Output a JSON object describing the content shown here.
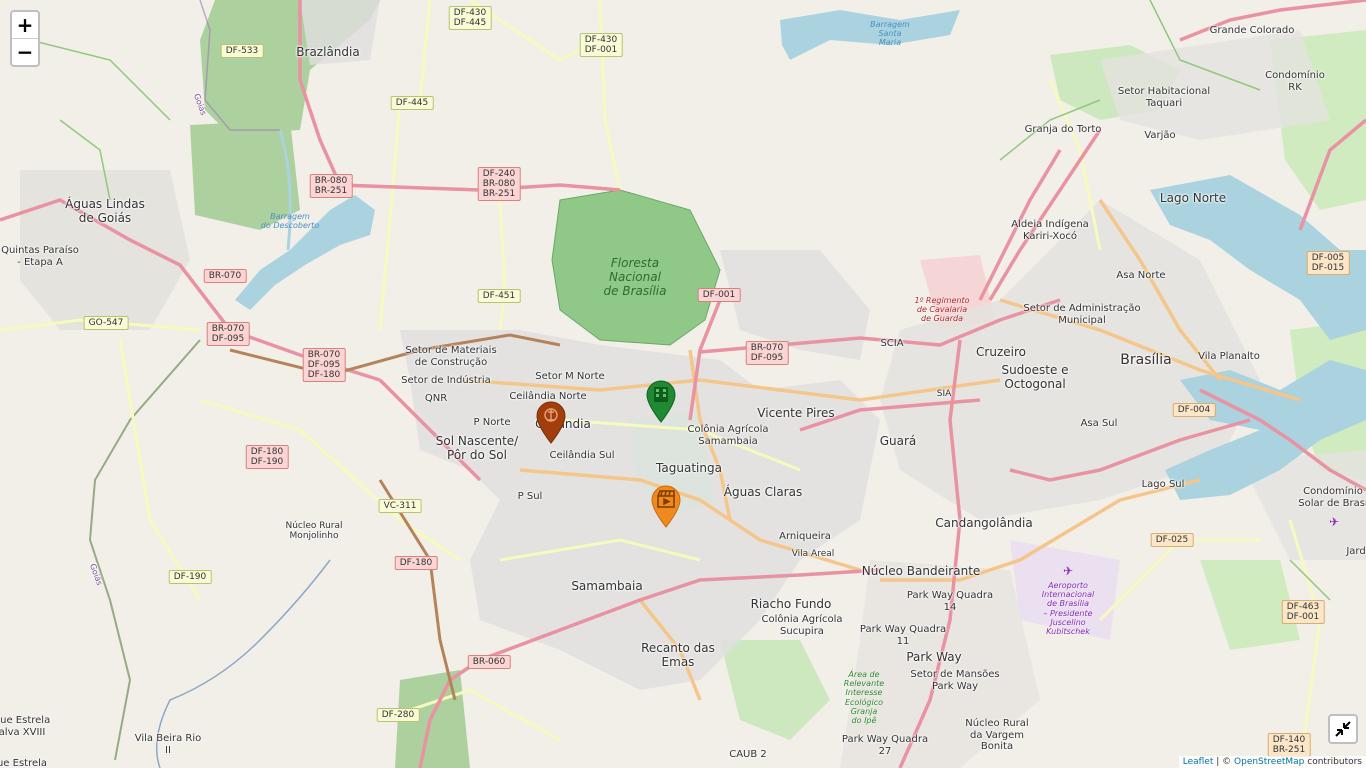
{
  "controls": {
    "zoom_in": "+",
    "zoom_out": "−",
    "fullscreen_icon": "collapse-arrows-icon"
  },
  "attribution": {
    "leaflet": "Leaflet",
    "sep": " | © ",
    "osm": "OpenStreetMap",
    "suffix": " contributors"
  },
  "colors": {
    "land": "#f2efe9",
    "water": "#aad3df",
    "forest": "#add19e",
    "park": "#c8facc",
    "road_major": "#e892a2",
    "road_primary": "#fcd6a4",
    "road_secondary": "#f7fabf",
    "marker_red": "#a23d0c",
    "marker_green": "#1f8a32",
    "marker_orange": "#f18a1e"
  },
  "places": {
    "brazlandia": "Brazlândia",
    "aguas_lindas": "Águas Lindas\nde Goiás",
    "quintas": "Quintas Paraíso\n- Etapa A",
    "grande_colorado": "Grande Colorado",
    "condominio_rk": "Condomínio\nRK",
    "taquari": "Setor Habitacional\nTaquari",
    "varjao": "Varjão",
    "granja_torto": "Granja do Torto",
    "lago_norte": "Lago Norte",
    "aldeia": "Aldeia Indígena\nKariri-Xocó",
    "asa_norte": "Asa Norte",
    "setor_admin": "Setor de Administração\nMunicipal",
    "brasilia": "Brasília",
    "vila_planalto": "Vila Planalto",
    "cruzeiro": "Cruzeiro",
    "sudoeste": "Sudoeste e\nOctogonal",
    "scia": "SCIA",
    "sia": "SIA",
    "asa_sul": "Asa Sul",
    "lago_sul": "Lago Sul",
    "condominio_solar": "Condomínio\nSolar de Brasí",
    "jardim": "Jard",
    "setor_materiais": "Setor de Materiais\nde Construção",
    "setor_industria": "Setor de Indústria",
    "setor_m_norte": "Setor M Norte",
    "qnr": "QNR",
    "ceilandia_norte": "Ceilândia Norte",
    "p_norte": "P Norte",
    "ceilandia": "Ceilândia",
    "sol_nascente": "Sol Nascente/\nPôr do Sol",
    "ceilandia_sul": "Ceilândia Sul",
    "p_sul": "P Sul",
    "colonia_samambaia": "Colônia Agrícola\nSamambaia",
    "vicente_pires": "Vicente Pires",
    "guara": "Guará",
    "taguatinga": "Taguatinga",
    "aguas_claras": "Águas Claras",
    "arniqueira": "Arniqueira",
    "vila_areal": "Vila Areal",
    "candangolandia": "Candangolândia",
    "nucleo_bandeirante": "Núcleo Bandeirante",
    "park_way_14": "Park Way Quadra\n14",
    "riacho_fundo": "Riacho Fundo",
    "colonia_sucupira": "Colônia Agrícola\nSucupira",
    "park_way_11": "Park Way Quadra\n11",
    "park_way": "Park Way",
    "setor_mansoes": "Setor de Mansões\nPark Way",
    "samambaia": "Samambaia",
    "recanto": "Recanto das\nEmas",
    "nucleo_rural_monjolinho": "Núcleo Rural\nMonjolinho",
    "nucleo_rural_vargem": "Núcleo Rural\nda Vargem\nBonita",
    "park_way_27": "Park Way Quadra\n27",
    "caub": "CAUB 2",
    "vila_beira_rio": "Vila Beira Rio\nII",
    "que_estrela": "que Estrela\nalva XVIII",
    "estrela": "ue Estrela",
    "goias1": "Goiás",
    "goias2": "Goiás"
  },
  "special_labels": {
    "barragem_santa_maria": "Barragem\nSanta\nMaria",
    "barragem_descoberto": "Barragem\ndo Descoberto",
    "floresta": "Floresta\nNacional\nde Brasília",
    "regimento": "1º Regimento\nde Cavalaria\nde Guarda",
    "aeroporto": "Aeroporto\nInternacional\nde Brasília\n– Presidente\nJuscelino\nKubitschek",
    "area_relevante": "Área de\nRelevante\nInteresse\nEcológico\nGranja\ndo Ipê"
  },
  "shields": {
    "df533": "DF-533",
    "df430_445": "DF-430\nDF-445",
    "df430_001": "DF-430\nDF-001",
    "df445": "DF-445",
    "br080_251": "BR-080\nBR-251",
    "df240": "DF-240\nBR-080\nBR-251",
    "br070": "BR-070",
    "br070_095": "BR-070\nDF-095",
    "br070_095_180": "BR-070\nDF-095\nDF-180",
    "df451": "DF-451",
    "df001": "DF-001",
    "br070_095_b": "BR-070\nDF-095",
    "go547": "GO-547",
    "df180_190": "DF-180\nDF-190",
    "vc311": "VC-311",
    "df180": "DF-180",
    "df190": "DF-190",
    "br060": "BR-060",
    "df280": "DF-280",
    "df005_015": "DF-005\nDF-015",
    "df004": "DF-004",
    "df025": "DF-025",
    "df463_001": "DF-463\nDF-001",
    "df140_br251": "DF-140\nBR-251"
  },
  "markers": [
    {
      "name": "marker-ceilandia",
      "color": "#a23d0c",
      "icon": "bank-icon"
    },
    {
      "name": "marker-taguatinga-north",
      "color": "#1f8a32",
      "icon": "building-icon"
    },
    {
      "name": "marker-taguatinga-south",
      "color": "#f18a1e",
      "icon": "movie-clapper-icon"
    }
  ]
}
